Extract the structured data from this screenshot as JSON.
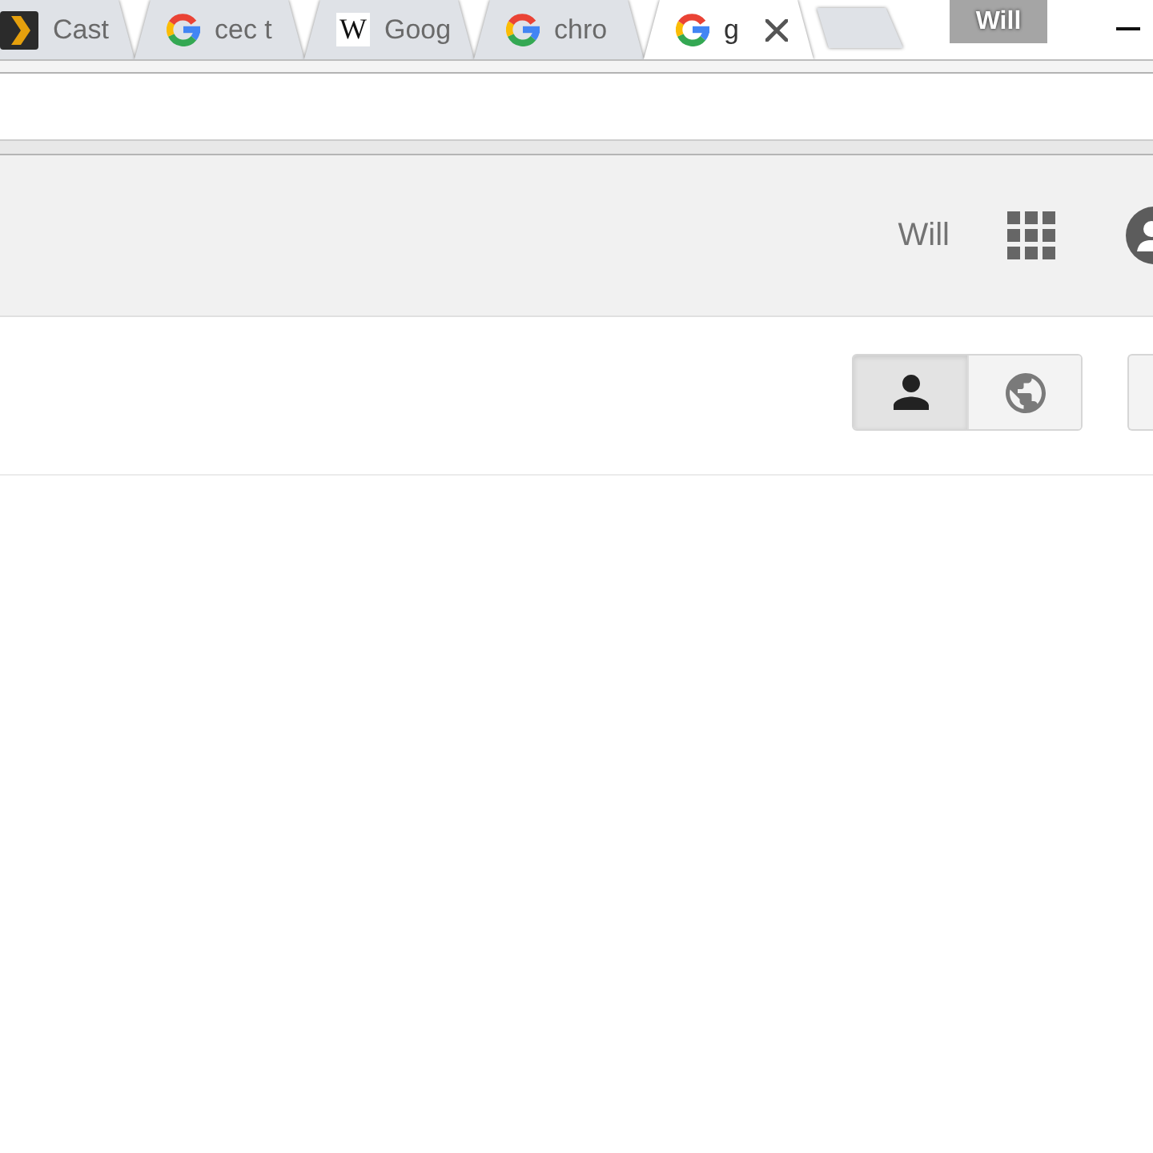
{
  "tab_strip": {
    "tabs": [
      {
        "kind": "chevron",
        "title": "Cast",
        "selected": false
      },
      {
        "kind": "google",
        "title": "cec t",
        "selected": false
      },
      {
        "kind": "letter",
        "icon_letter": "W",
        "title": "Goog",
        "selected": false
      },
      {
        "kind": "google",
        "title": "chro",
        "selected": false
      },
      {
        "kind": "google",
        "title": "g",
        "selected": true
      }
    ],
    "profile_button": "Will"
  },
  "google_bar": {
    "user_name": "Will"
  },
  "view_toggle": [
    {
      "kind": "person",
      "selected": true
    },
    {
      "kind": "globe",
      "selected": false
    }
  ]
}
